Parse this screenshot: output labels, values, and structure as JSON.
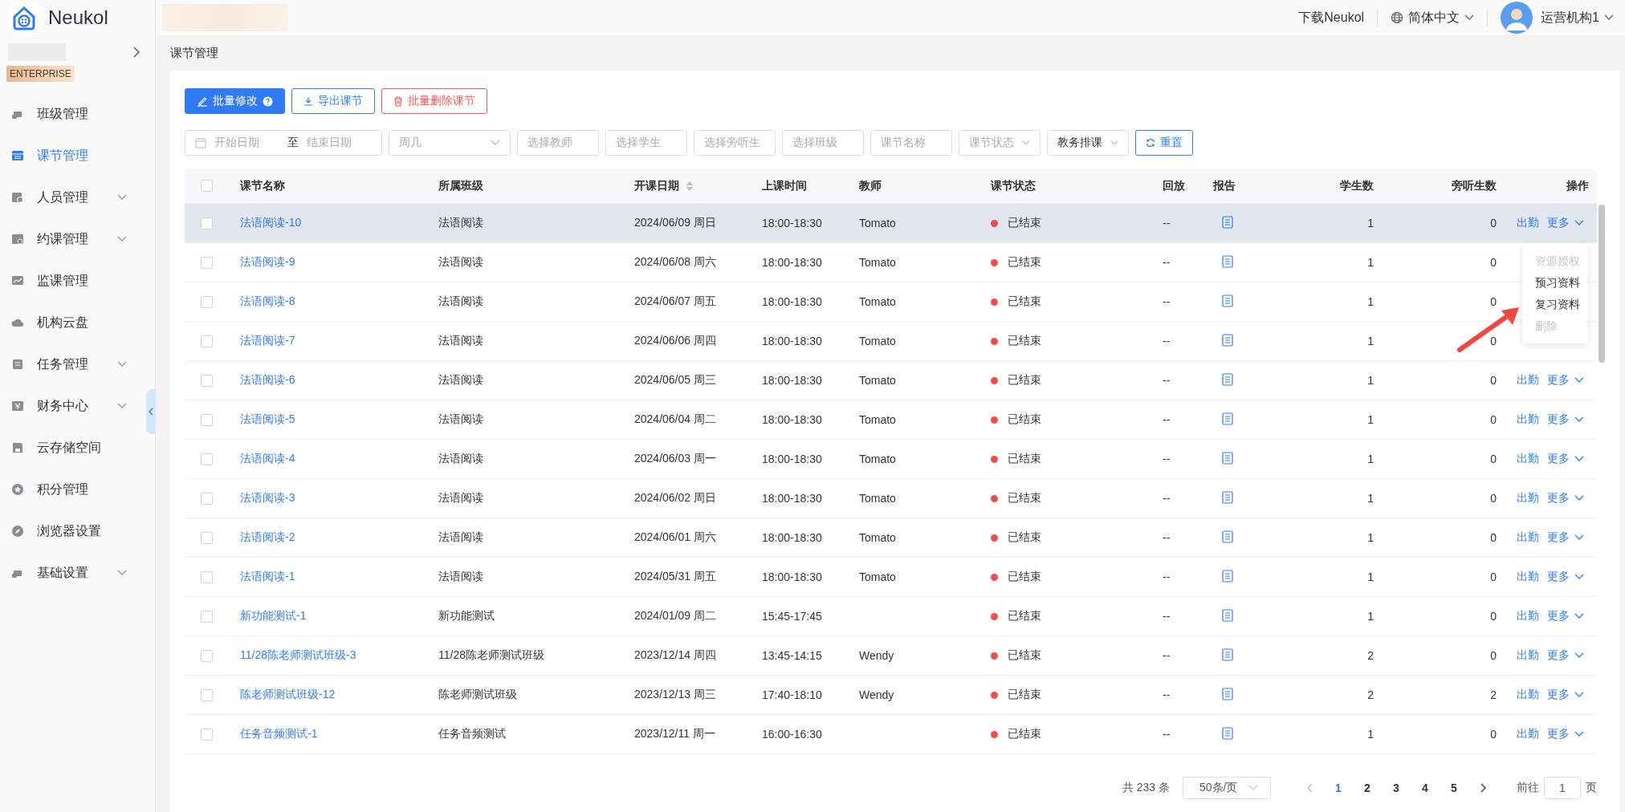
{
  "brand": {
    "name": "Neukol"
  },
  "topbar": {
    "download": "下载Neukol",
    "language": "简体中文",
    "user": "运营机构1"
  },
  "sidebar": {
    "badge": "ENTERPRISE",
    "items": [
      {
        "label": "班级管理",
        "selected": false,
        "expandable": false
      },
      {
        "label": "课节管理",
        "selected": true,
        "expandable": false
      },
      {
        "label": "人员管理",
        "selected": false,
        "expandable": true
      },
      {
        "label": "约课管理",
        "selected": false,
        "expandable": true
      },
      {
        "label": "监课管理",
        "selected": false,
        "expandable": false
      },
      {
        "label": "机构云盘",
        "selected": false,
        "expandable": false
      },
      {
        "label": "任务管理",
        "selected": false,
        "expandable": true
      },
      {
        "label": "财务中心",
        "selected": false,
        "expandable": true
      },
      {
        "label": "云存储空间",
        "selected": false,
        "expandable": false
      },
      {
        "label": "积分管理",
        "selected": false,
        "expandable": false
      },
      {
        "label": "浏览器设置",
        "selected": false,
        "expandable": false
      },
      {
        "label": "基础设置",
        "selected": false,
        "expandable": true
      }
    ]
  },
  "breadcrumb": "课节管理",
  "actions": [
    {
      "label": "批量修改",
      "kind": "primary"
    },
    {
      "label": "导出课节",
      "kind": "outline"
    },
    {
      "label": "批量删除课节",
      "kind": "danger"
    }
  ],
  "filters": [
    {
      "kind": "date-range",
      "start": "开始日期",
      "separator": "至",
      "end": "结束日期"
    },
    {
      "kind": "select",
      "placeholder": "周几"
    },
    {
      "kind": "input",
      "placeholder": "选择教师"
    },
    {
      "kind": "input",
      "placeholder": "选择学生"
    },
    {
      "kind": "input",
      "placeholder": "选择旁听生"
    },
    {
      "kind": "input",
      "placeholder": "选择班级"
    },
    {
      "kind": "input",
      "placeholder": "课节名称"
    },
    {
      "kind": "select",
      "placeholder": "课节状态"
    },
    {
      "kind": "select",
      "value": "教务排课"
    },
    {
      "kind": "reset",
      "label": "重置"
    }
  ],
  "table": {
    "header_checked": false,
    "columns": [
      "课节名称",
      "所属班级",
      "开课日期",
      "上课时间",
      "教师",
      "课节状态",
      "回放",
      "报告",
      "学生数",
      "旁听生数",
      "操作"
    ],
    "rows": [
      {
        "checked": false,
        "hovered": true,
        "name": "法语阅读-10",
        "class": "法语阅读",
        "date": "2024/06/09 周日",
        "time": "18:00-18:30",
        "teacher": "Tomato",
        "status": "已结束",
        "replay": "--",
        "students": "1",
        "auditors": "0",
        "attendance": "出勤",
        "more": "更多"
      },
      {
        "checked": false,
        "hovered": false,
        "name": "法语阅读-9",
        "class": "法语阅读",
        "date": "2024/06/08 周六",
        "time": "18:00-18:30",
        "teacher": "Tomato",
        "status": "已结束",
        "replay": "--",
        "students": "1",
        "auditors": "0"
      },
      {
        "checked": false,
        "hovered": false,
        "name": "法语阅读-8",
        "class": "法语阅读",
        "date": "2024/06/07 周五",
        "time": "18:00-18:30",
        "teacher": "Tomato",
        "status": "已结束",
        "replay": "--",
        "students": "1",
        "auditors": "0"
      },
      {
        "checked": false,
        "hovered": false,
        "name": "法语阅读-7",
        "class": "法语阅读",
        "date": "2024/06/06 周四",
        "time": "18:00-18:30",
        "teacher": "Tomato",
        "status": "已结束",
        "replay": "--",
        "students": "1",
        "auditors": "0"
      },
      {
        "checked": false,
        "hovered": false,
        "name": "法语阅读-6",
        "class": "法语阅读",
        "date": "2024/06/05 周三",
        "time": "18:00-18:30",
        "teacher": "Tomato",
        "status": "已结束",
        "replay": "--",
        "students": "1",
        "auditors": "0",
        "attendance": "出勤",
        "more": "更多"
      },
      {
        "checked": false,
        "hovered": false,
        "name": "法语阅读-5",
        "class": "法语阅读",
        "date": "2024/06/04 周二",
        "time": "18:00-18:30",
        "teacher": "Tomato",
        "status": "已结束",
        "replay": "--",
        "students": "1",
        "auditors": "0",
        "attendance": "出勤",
        "more": "更多"
      },
      {
        "checked": false,
        "hovered": false,
        "name": "法语阅读-4",
        "class": "法语阅读",
        "date": "2024/06/03 周一",
        "time": "18:00-18:30",
        "teacher": "Tomato",
        "status": "已结束",
        "replay": "--",
        "students": "1",
        "auditors": "0",
        "attendance": "出勤",
        "more": "更多"
      },
      {
        "checked": false,
        "hovered": false,
        "name": "法语阅读-3",
        "class": "法语阅读",
        "date": "2024/06/02 周日",
        "time": "18:00-18:30",
        "teacher": "Tomato",
        "status": "已结束",
        "replay": "--",
        "students": "1",
        "auditors": "0",
        "attendance": "出勤",
        "more": "更多"
      },
      {
        "checked": false,
        "hovered": false,
        "name": "法语阅读-2",
        "class": "法语阅读",
        "date": "2024/06/01 周六",
        "time": "18:00-18:30",
        "teacher": "Tomato",
        "status": "已结束",
        "replay": "--",
        "students": "1",
        "auditors": "0",
        "attendance": "出勤",
        "more": "更多"
      },
      {
        "checked": false,
        "hovered": false,
        "name": "法语阅读-1",
        "class": "法语阅读",
        "date": "2024/05/31 周五",
        "time": "18:00-18:30",
        "teacher": "Tomato",
        "status": "已结束",
        "replay": "--",
        "students": "1",
        "auditors": "0",
        "attendance": "出勤",
        "more": "更多"
      },
      {
        "checked": false,
        "hovered": false,
        "name": "新功能测试-1",
        "class": "新功能测试",
        "date": "2024/01/09 周二",
        "time": "15:45-17:45",
        "status": "已结束",
        "replay": "--",
        "students": "1",
        "auditors": "0",
        "attendance": "出勤",
        "more": "更多"
      },
      {
        "checked": false,
        "hovered": false,
        "name": "11/28陈老师测试班级-3",
        "class": "11/28陈老师测试班级",
        "date": "2023/12/14 周四",
        "time": "13:45-14:15",
        "teacher": "Wendy",
        "status": "已结束",
        "replay": "--",
        "students": "2",
        "auditors": "0",
        "attendance": "出勤",
        "more": "更多"
      },
      {
        "checked": false,
        "hovered": false,
        "name": "陈老师测试班级-12",
        "class": "陈老师测试班级",
        "date": "2023/12/13 周三",
        "time": "17:40-18:10",
        "teacher": "Wendy",
        "status": "已结束",
        "replay": "--",
        "students": "2",
        "auditors": "2",
        "attendance": "出勤",
        "more": "更多"
      },
      {
        "checked": false,
        "hovered": false,
        "name": "任务音频测试-1",
        "class": "任务音频测试",
        "date": "2023/12/11 周一",
        "time": "16:00-16:30",
        "status": "已结束",
        "replay": "--",
        "students": "1",
        "auditors": "0",
        "attendance": "出勤",
        "more": "更多"
      }
    ]
  },
  "more_menu": [
    {
      "label": "资源授权",
      "disabled": true
    },
    {
      "label": "预习资料",
      "disabled": false
    },
    {
      "label": "复习资料",
      "disabled": false
    },
    {
      "label": "删除",
      "disabled": true
    }
  ],
  "pagination": {
    "total": "共 233 条",
    "page_size": "50条/页",
    "pages": [
      {
        "label": "1",
        "selected": true
      },
      {
        "label": "2",
        "selected": false
      },
      {
        "label": "3",
        "selected": false
      },
      {
        "label": "4",
        "selected": false
      },
      {
        "label": "5",
        "selected": false
      }
    ],
    "goto_label": "前往",
    "goto_value": "1",
    "goto_unit": "页"
  }
}
